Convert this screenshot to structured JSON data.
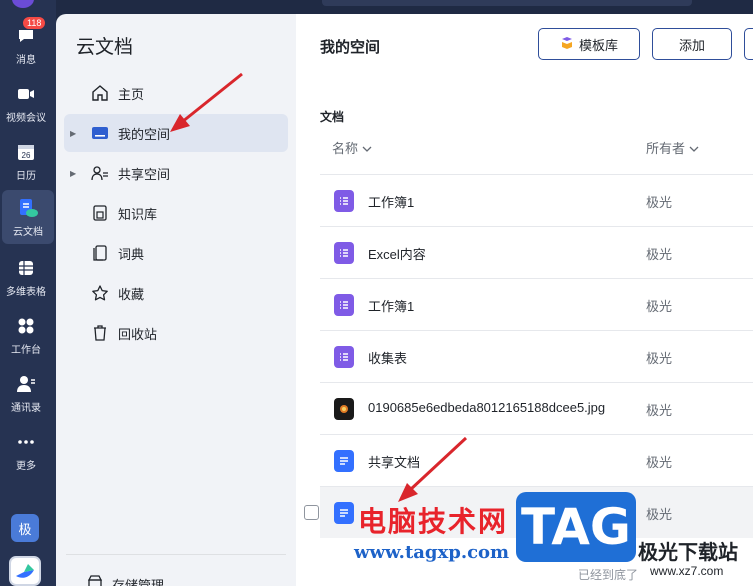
{
  "rail": {
    "badge": "118",
    "items": [
      {
        "label": "消息",
        "icon": "chat-icon"
      },
      {
        "label": "视频会议",
        "icon": "video-icon"
      },
      {
        "label": "日历",
        "icon": "calendar-icon",
        "date": "26"
      },
      {
        "label": "云文档",
        "icon": "cloud-doc-icon"
      },
      {
        "label": "多维表格",
        "icon": "table-icon"
      },
      {
        "label": "工作台",
        "icon": "workbench-icon"
      },
      {
        "label": "通讯录",
        "icon": "contacts-icon"
      },
      {
        "label": "更多",
        "icon": "more-icon"
      }
    ],
    "avatar": "极"
  },
  "nav": {
    "title": "云文档",
    "items": [
      {
        "label": "主页",
        "icon": "home-icon"
      },
      {
        "label": "我的空间",
        "icon": "folder-icon"
      },
      {
        "label": "共享空间",
        "icon": "users-icon"
      },
      {
        "label": "知识库",
        "icon": "book-icon"
      },
      {
        "label": "词典",
        "icon": "dictionary-icon"
      },
      {
        "label": "收藏",
        "icon": "star-icon"
      },
      {
        "label": "回收站",
        "icon": "trash-icon"
      }
    ],
    "storage": "存储管理"
  },
  "main": {
    "title": "我的空间",
    "template_button": "模板库",
    "add_button": "添加",
    "section": "文档",
    "col_name": "名称",
    "col_owner": "所有者",
    "files": [
      {
        "name": "工作簿1",
        "owner": "极光",
        "icon": "sheet-icon",
        "color": "#7f5be6"
      },
      {
        "name": "Excel内容",
        "owner": "极光",
        "icon": "sheet-icon",
        "color": "#7f5be6"
      },
      {
        "name": "工作簿1",
        "owner": "极光",
        "icon": "sheet-icon",
        "color": "#7f5be6"
      },
      {
        "name": "收集表",
        "owner": "极光",
        "icon": "sheet-icon",
        "color": "#7f5be6"
      },
      {
        "name": "0190685e6edbeda8012165188dcee5.jpg",
        "owner": "极光",
        "icon": "image-icon",
        "color": "#1a1a1a"
      },
      {
        "name": "共享文档",
        "owner": "极光",
        "icon": "doc-icon",
        "color": "#3370ff"
      },
      {
        "name": "",
        "owner": "极光",
        "icon": "doc-icon",
        "color": "#3370ff"
      }
    ],
    "end_text": "已经到底了"
  },
  "watermark": {
    "cn": "电脑技术网",
    "url": "www.tagxp.com",
    "logo": "TAG",
    "site": "极光下载站",
    "site_url": "www.xz7.com"
  },
  "colors": {
    "accent": "#3370ff",
    "annotation": "#d9262c"
  }
}
